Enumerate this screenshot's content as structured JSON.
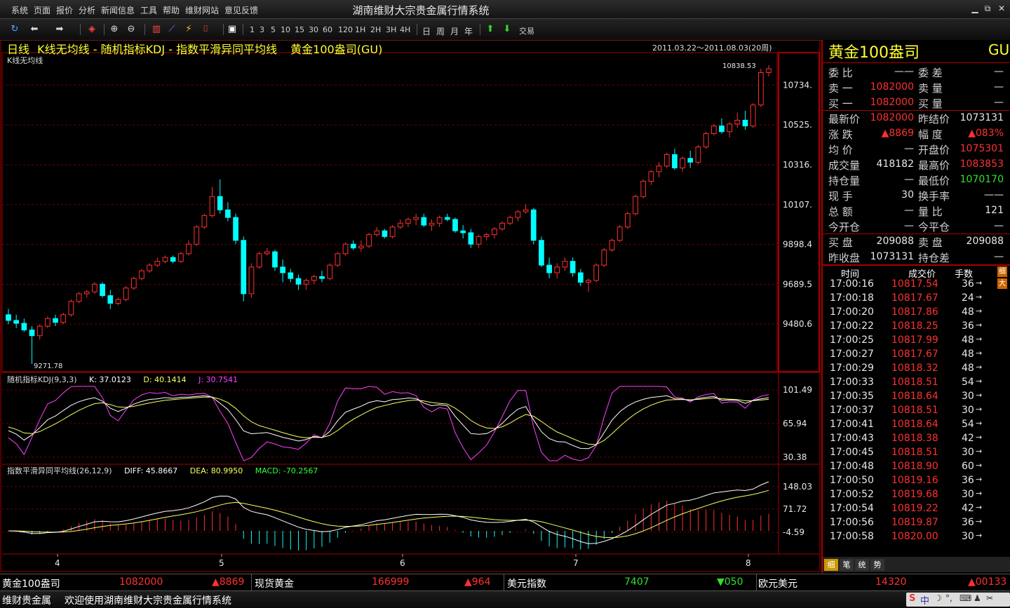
{
  "window": {
    "title": "湖南维财大宗贵金属行情系统",
    "menu": [
      "系统",
      "页面",
      "报价",
      "分析",
      "新闻信息",
      "工具",
      "帮助",
      "维财网站",
      "意见反馈"
    ],
    "controls": [
      "▁",
      "⧉",
      "✕"
    ]
  },
  "toolbar": {
    "periods": [
      "1",
      "3",
      "5",
      "10",
      "15",
      "30",
      "60",
      "120",
      "1H",
      "2H",
      "3H",
      "4H"
    ],
    "cycles": [
      "日",
      "周",
      "月",
      "年"
    ],
    "trade_label": "交易"
  },
  "chart": {
    "header": {
      "period": "日线",
      "indicator_main": "K线无均线",
      "indicator_kdj": "随机指标KDJ",
      "indicator_macd": "指数平滑异同平均线",
      "instrument": "黄金100盎司(GU)",
      "range": "2011.03.22～2011.08.03(20周)"
    },
    "main_label": "K线无均线",
    "max_label": "10838.53",
    "min_label": "9271.78",
    "price_axis": [
      "10734.",
      "10525.",
      "10316.",
      "10107.",
      "9898.4",
      "9689.5",
      "9480.6"
    ],
    "kdj": {
      "label": "随机指标KDJ(9,3,3)",
      "k": "K: 37.0123",
      "d": "D: 40.1414",
      "j": "J: 30.7541",
      "axis": [
        "101.49",
        "65.94",
        "30.38"
      ]
    },
    "macd": {
      "label": "指数平滑异同平均线(26,12,9)",
      "diff": "DIFF: 45.8667",
      "dea": "DEA: 80.9950",
      "macd": "MACD: -70.2567",
      "axis": [
        "148.03",
        "71.72",
        "-4.59"
      ]
    },
    "x_axis": [
      "4",
      "5",
      "6",
      "7",
      "8"
    ]
  },
  "chart_data": {
    "type": "candlestick",
    "instrument": "黄金100盎司(GU)",
    "period": "日线",
    "y_range": [
      9271.78,
      10838.53
    ],
    "candles": [
      [
        9530,
        9560,
        9480,
        9500
      ],
      [
        9500,
        9530,
        9460,
        9485
      ],
      [
        9485,
        9510,
        9440,
        9450
      ],
      [
        9450,
        9470,
        9271.78,
        9420
      ],
      [
        9420,
        9480,
        9400,
        9470
      ],
      [
        9470,
        9520,
        9460,
        9510
      ],
      [
        9510,
        9530,
        9470,
        9490
      ],
      [
        9490,
        9540,
        9480,
        9530
      ],
      [
        9530,
        9610,
        9520,
        9600
      ],
      [
        9600,
        9650,
        9590,
        9640
      ],
      [
        9640,
        9660,
        9620,
        9650
      ],
      [
        9650,
        9700,
        9640,
        9690
      ],
      [
        9690,
        9700,
        9620,
        9630
      ],
      [
        9630,
        9660,
        9560,
        9590
      ],
      [
        9590,
        9620,
        9580,
        9610
      ],
      [
        9610,
        9680,
        9600,
        9670
      ],
      [
        9670,
        9730,
        9660,
        9720
      ],
      [
        9720,
        9770,
        9710,
        9760
      ],
      [
        9760,
        9800,
        9750,
        9790
      ],
      [
        9790,
        9830,
        9780,
        9810
      ],
      [
        9810,
        9840,
        9800,
        9830
      ],
      [
        9830,
        9840,
        9800,
        9810
      ],
      [
        9810,
        9860,
        9800,
        9850
      ],
      [
        9850,
        9920,
        9840,
        9900
      ],
      [
        9900,
        10000,
        9890,
        9990
      ],
      [
        9990,
        10060,
        9980,
        10050
      ],
      [
        10050,
        10200,
        10040,
        10150
      ],
      [
        10150,
        10240,
        10060,
        10080
      ],
      [
        10080,
        10120,
        10020,
        10040
      ],
      [
        10040,
        10060,
        9900,
        9920
      ],
      [
        9920,
        9940,
        9600,
        9640
      ],
      [
        9640,
        9800,
        9620,
        9780
      ],
      [
        9780,
        9860,
        9770,
        9850
      ],
      [
        9850,
        9880,
        9840,
        9860
      ],
      [
        9860,
        9870,
        9760,
        9780
      ],
      [
        9780,
        9820,
        9700,
        9750
      ],
      [
        9750,
        9770,
        9700,
        9720
      ],
      [
        9720,
        9740,
        9660,
        9690
      ],
      [
        9690,
        9720,
        9660,
        9710
      ],
      [
        9710,
        9740,
        9690,
        9730
      ],
      [
        9730,
        9760,
        9700,
        9720
      ],
      [
        9720,
        9800,
        9710,
        9790
      ],
      [
        9790,
        9860,
        9780,
        9850
      ],
      [
        9850,
        9910,
        9840,
        9900
      ],
      [
        9900,
        9920,
        9870,
        9880
      ],
      [
        9880,
        9920,
        9860,
        9890
      ],
      [
        9890,
        9960,
        9880,
        9950
      ],
      [
        9950,
        9990,
        9940,
        9970
      ],
      [
        9970,
        9980,
        9930,
        9940
      ],
      [
        9940,
        10000,
        9930,
        9990
      ],
      [
        9990,
        10030,
        9980,
        10010
      ],
      [
        10010,
        10040,
        9990,
        10030
      ],
      [
        10030,
        10060,
        10000,
        10040
      ],
      [
        10040,
        10060,
        9990,
        10000
      ],
      [
        10000,
        10030,
        9970,
        10010
      ],
      [
        10010,
        10050,
        9990,
        10040
      ],
      [
        10040,
        10060,
        10020,
        10030
      ],
      [
        10030,
        10040,
        9960,
        9970
      ],
      [
        9970,
        10000,
        9930,
        9960
      ],
      [
        9960,
        9980,
        9880,
        9900
      ],
      [
        9900,
        9950,
        9880,
        9940
      ],
      [
        9940,
        9960,
        9920,
        9950
      ],
      [
        9950,
        9990,
        9930,
        9980
      ],
      [
        9980,
        10020,
        9970,
        10010
      ],
      [
        10010,
        10050,
        10000,
        10040
      ],
      [
        10040,
        10080,
        10020,
        10070
      ],
      [
        10070,
        10110,
        10060,
        10080
      ],
      [
        10080,
        10090,
        9900,
        9920
      ],
      [
        9920,
        9940,
        9780,
        9790
      ],
      [
        9790,
        9830,
        9720,
        9750
      ],
      [
        9750,
        9800,
        9720,
        9780
      ],
      [
        9780,
        9830,
        9760,
        9810
      ],
      [
        9810,
        9830,
        9730,
        9750
      ],
      [
        9750,
        9770,
        9680,
        9700
      ],
      [
        9700,
        9720,
        9650,
        9710
      ],
      [
        9710,
        9800,
        9700,
        9790
      ],
      [
        9790,
        9880,
        9780,
        9870
      ],
      [
        9870,
        9930,
        9860,
        9920
      ],
      [
        9920,
        10000,
        9910,
        9990
      ],
      [
        9990,
        10070,
        9980,
        10060
      ],
      [
        10060,
        10160,
        10050,
        10150
      ],
      [
        10150,
        10240,
        10140,
        10230
      ],
      [
        10230,
        10290,
        10210,
        10280
      ],
      [
        10280,
        10330,
        10250,
        10310
      ],
      [
        10310,
        10380,
        10300,
        10370
      ],
      [
        10370,
        10400,
        10290,
        10300
      ],
      [
        10300,
        10360,
        10280,
        10350
      ],
      [
        10350,
        10390,
        10300,
        10330
      ],
      [
        10330,
        10420,
        10320,
        10410
      ],
      [
        10410,
        10490,
        10400,
        10480
      ],
      [
        10480,
        10530,
        10470,
        10520
      ],
      [
        10520,
        10560,
        10480,
        10490
      ],
      [
        10490,
        10540,
        10460,
        10530
      ],
      [
        10530,
        10590,
        10510,
        10550
      ],
      [
        10550,
        10600,
        10500,
        10520
      ],
      [
        10520,
        10640,
        10510,
        10630
      ],
      [
        10630,
        10820,
        10620,
        10800
      ],
      [
        10800,
        10838.53,
        10780,
        10820
      ]
    ],
    "kdj": {
      "k": 37.0123,
      "d": 40.1414,
      "j": 30.7541,
      "y_range": [
        30.38,
        101.49
      ]
    },
    "macd": {
      "diff": 45.8667,
      "dea": 80.995,
      "macd": -70.2567,
      "y_range": [
        -4.59,
        148.03
      ]
    }
  },
  "quote": {
    "name": "黄金100盎司",
    "code": "GU",
    "rows": [
      {
        "l1": "委  比",
        "v1": "——",
        "l2": "委  差",
        "v2": "—",
        "c1": "white",
        "c2": "white"
      },
      {
        "l1": "卖  一",
        "v1": "1082000",
        "l2": "卖  量",
        "v2": "—",
        "c1": "red",
        "c2": "white"
      },
      {
        "l1": "买  一",
        "v1": "1082000",
        "l2": "买  量",
        "v2": "—",
        "c1": "red",
        "c2": "white"
      },
      {
        "l1": "最新价",
        "v1": "1082000",
        "l2": "昨结价",
        "v2": "1073131",
        "c1": "red",
        "c2": "white"
      },
      {
        "l1": "涨  跌",
        "v1": "▲8869",
        "l2": "幅  度",
        "v2": "▲083%",
        "c1": "red",
        "c2": "red"
      },
      {
        "l1": "均  价",
        "v1": "—",
        "l2": "开盘价",
        "v2": "1075301",
        "c1": "white",
        "c2": "red"
      },
      {
        "l1": "成交量",
        "v1": "418182",
        "l2": "最高价",
        "v2": "1083853",
        "c1": "white",
        "c2": "red"
      },
      {
        "l1": "持仓量",
        "v1": "—",
        "l2": "最低价",
        "v2": "1070170",
        "c1": "white",
        "c2": "green"
      },
      {
        "l1": "现  手",
        "v1": "30",
        "l2": "换手率",
        "v2": "——",
        "c1": "white",
        "c2": "white"
      },
      {
        "l1": "总  额",
        "v1": "—",
        "l2": "量  比",
        "v2": "121",
        "c1": "white",
        "c2": "white"
      },
      {
        "l1": "今开仓",
        "v1": "—",
        "l2": "今平仓",
        "v2": "—",
        "c1": "white",
        "c2": "white"
      },
      {
        "l1": "买  盘",
        "v1": "209088",
        "l2": "卖  盘",
        "v2": "209088",
        "c1": "white",
        "c2": "white"
      },
      {
        "l1": "昨收盘",
        "v1": "1073131",
        "l2": "持仓差",
        "v2": "—",
        "c1": "white",
        "c2": "white"
      }
    ],
    "tick_headers": [
      "时间",
      "成交价",
      "手数"
    ],
    "ticks": [
      [
        "17:00:16",
        "10817.54",
        "36"
      ],
      [
        "17:00:18",
        "10817.67",
        "24"
      ],
      [
        "17:00:20",
        "10817.86",
        "48"
      ],
      [
        "17:00:22",
        "10818.25",
        "36"
      ],
      [
        "17:00:25",
        "10817.99",
        "48"
      ],
      [
        "17:00:27",
        "10817.67",
        "48"
      ],
      [
        "17:00:29",
        "10818.32",
        "48"
      ],
      [
        "17:00:33",
        "10818.51",
        "54"
      ],
      [
        "17:00:35",
        "10818.64",
        "30"
      ],
      [
        "17:00:37",
        "10818.51",
        "30"
      ],
      [
        "17:00:41",
        "10818.64",
        "54"
      ],
      [
        "17:00:43",
        "10818.38",
        "42"
      ],
      [
        "17:00:45",
        "10818.51",
        "30"
      ],
      [
        "17:00:48",
        "10818.90",
        "60"
      ],
      [
        "17:00:50",
        "10819.16",
        "36"
      ],
      [
        "17:00:52",
        "10819.68",
        "30"
      ],
      [
        "17:00:54",
        "10819.22",
        "42"
      ],
      [
        "17:00:56",
        "10819.87",
        "36"
      ],
      [
        "17:00:58",
        "10820.00",
        "30"
      ]
    ],
    "side_tabs": [
      "细",
      "大"
    ],
    "bottom_tabs": [
      "细",
      "笔",
      "统",
      "势"
    ]
  },
  "ticker": [
    {
      "name": "黄金100盎司",
      "price": "1082000",
      "chg": "▲8869",
      "dir": "up"
    },
    {
      "name": "现货黄金",
      "price": "166999",
      "chg": "▲964",
      "dir": "up"
    },
    {
      "name": "美元指数",
      "price": "7407",
      "chg": "▼050",
      "dir": "down"
    },
    {
      "name": "欧元美元",
      "price": "14320",
      "chg": "▲00133",
      "dir": "up"
    }
  ],
  "status": {
    "company": "维财贵金属",
    "message": "欢迎使用湖南维财大宗贵金属行情系统"
  },
  "colors": {
    "up": "#ff3030",
    "down": "#00ffff",
    "frame": "#a00000",
    "kdj_k": "#ffffff",
    "kdj_d": "#ffff60",
    "kdj_j": "#ff40ff"
  }
}
